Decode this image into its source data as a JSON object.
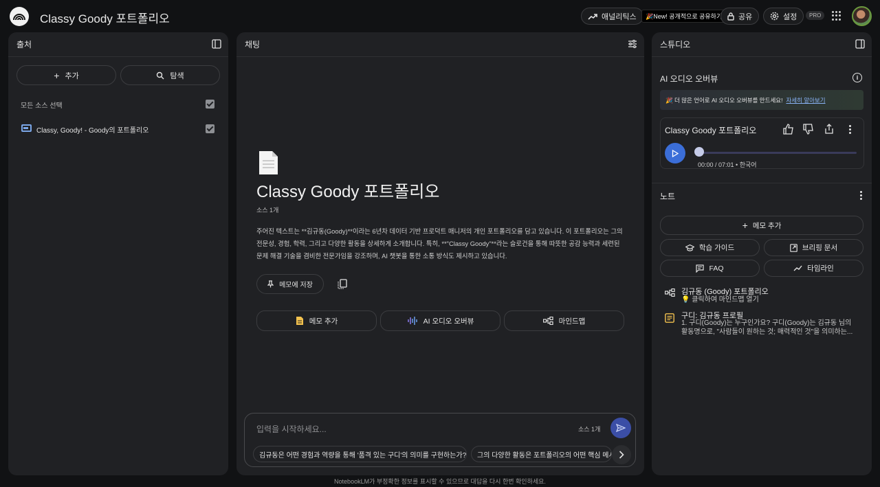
{
  "header": {
    "title": "Classy Goody 포트폴리오",
    "analytics": "애널리틱스",
    "new_share": "🎉New! 공개적으로 공유하기",
    "share": "공유",
    "settings": "설정",
    "pro": "PRO"
  },
  "sources": {
    "title": "출처",
    "add": "추가",
    "explore": "탐색",
    "select_all": "모든 소스 선택",
    "items": [
      {
        "label": "Classy, Goody! - Goody의 포트폴리오",
        "checked": true
      }
    ]
  },
  "chat": {
    "title": "채팅",
    "doc_title": "Classy Goody 포트폴리오",
    "source_count": "소스 1개",
    "summary": "주어진 텍스트는 **김규동(Goody)**이라는 6년차 데이터 기반 프로덕트 매니저의 개인 포트폴리오를 담고 있습니다. 이 포트폴리오는 그의 전문성, 경험, 학력, 그리고 다양한 활동을 상세하게 소개합니다. 특히, **\"Classy Goody\"**라는 슬로건을 통해 따뜻한 공감 능력과 세련된 문제 해결 기술을 겸비한 전문가임을 강조하며, AI 챗봇을 통한 소통 방식도 제시하고 있습니다.",
    "save_to_memo": "메모에 저장",
    "actions": [
      "메모 추가",
      "AI 오디오 오버뷰",
      "마인드맵"
    ],
    "input_placeholder": "입력을 시작하세요...",
    "input_source_count": "소스 1개",
    "suggestions": [
      "김규동은 어떤 경험과 역량을 통해 '품격 있는 구디'의 의미를 구현하는가?",
      "그의 다양한 활동은 포트폴리오의 어떤 핵심 메시지를"
    ]
  },
  "studio": {
    "title": "스튜디오",
    "audio_overview_title": "AI 오디오 오버뷰",
    "banner_text": "🎉 더 많은 언어로 AI 오디오 오버뷰를 만드세요!",
    "banner_link": "자세히 알아보기",
    "audio": {
      "title": "Classy Goody 포트폴리오",
      "time": "00:00 / 07:01 • 한국어",
      "progress": 0
    },
    "notes_title": "노트",
    "add_memo": "메모 추가",
    "note_buttons": [
      "학습 가이드",
      "브리핑 문서",
      "FAQ",
      "타임라인"
    ],
    "notes": [
      {
        "title": "김규동 (Goody) 포트폴리오",
        "sub": "💡 클릭하여 마인드맵 열기",
        "icon": "mindmap-icon"
      },
      {
        "title": "구디: 김규동 프로필",
        "sub": "1. 구디(Goody)는 누구인가요? 구디(Goody)는 김규동 님의 활동명으로, \"사람들이 원하는 것; 매력적인 것\"을 의미하는...",
        "icon": "note-icon"
      }
    ]
  },
  "footer": "NotebookLM가 부정확한 정보를 표시할 수 있으므로 대답을 다시 한번 확인하세요."
}
